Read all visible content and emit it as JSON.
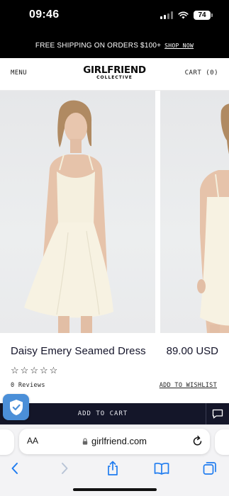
{
  "status_bar": {
    "time": "09:46",
    "battery": "74"
  },
  "promo": {
    "text": "FREE SHIPPING ON ORDERS $100+",
    "link": "SHOP NOW"
  },
  "header": {
    "menu_label": "MENU",
    "logo_main": "GIRLFRIEND",
    "logo_sub": "COLLECTIVE",
    "cart_label": "CART (0)"
  },
  "product": {
    "title": "Daisy Emery Seamed Dress",
    "price": "89.00 USD",
    "rating": 0,
    "rating_max": 5,
    "star_glyph": "☆",
    "reviews_label": "0 Reviews",
    "wishlist_label": "ADD TO WISHLIST",
    "images": [
      "dress-photo-front",
      "dress-photo-side"
    ]
  },
  "cart_bar": {
    "add_to_cart_label": "ADD TO CART"
  },
  "browser": {
    "aa_label": "AA",
    "url": "girlfriend.com"
  },
  "colors": {
    "cart_bar": "#141629",
    "text_dark": "#14142a",
    "ios_blue": "#1f7cf0",
    "shield_badge": "#4b8fd8"
  }
}
